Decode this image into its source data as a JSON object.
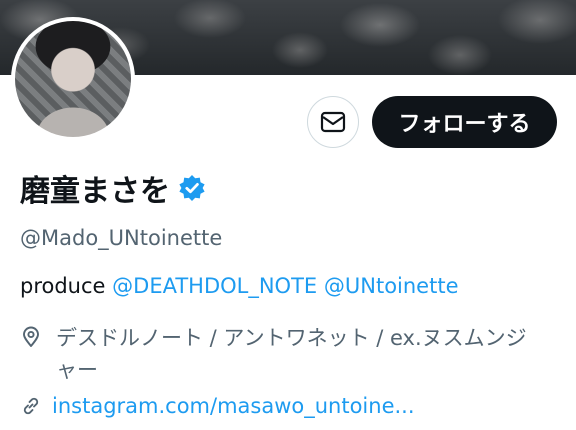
{
  "profile": {
    "display_name": "磨童まさを",
    "handle": "@Mado_UNtoinette",
    "verified": true
  },
  "actions": {
    "follow_label": "フォローする",
    "dm_icon": "envelope-icon"
  },
  "bio": {
    "text": "produce",
    "mentions": [
      "@DEATHDOL_NOTE",
      "@UNtoinette"
    ]
  },
  "location": {
    "icon": "location-pin-icon",
    "text": "デスドルノート / アントワネット / ex.ヌスムンジャー"
  },
  "website": {
    "icon": "link-icon",
    "text": "instagram.com/masawo_untoine..."
  },
  "colors": {
    "accent": "#1d9bf0",
    "text_primary": "#0f1419",
    "text_secondary": "#536471",
    "follow_button_bg": "#0f1419"
  }
}
